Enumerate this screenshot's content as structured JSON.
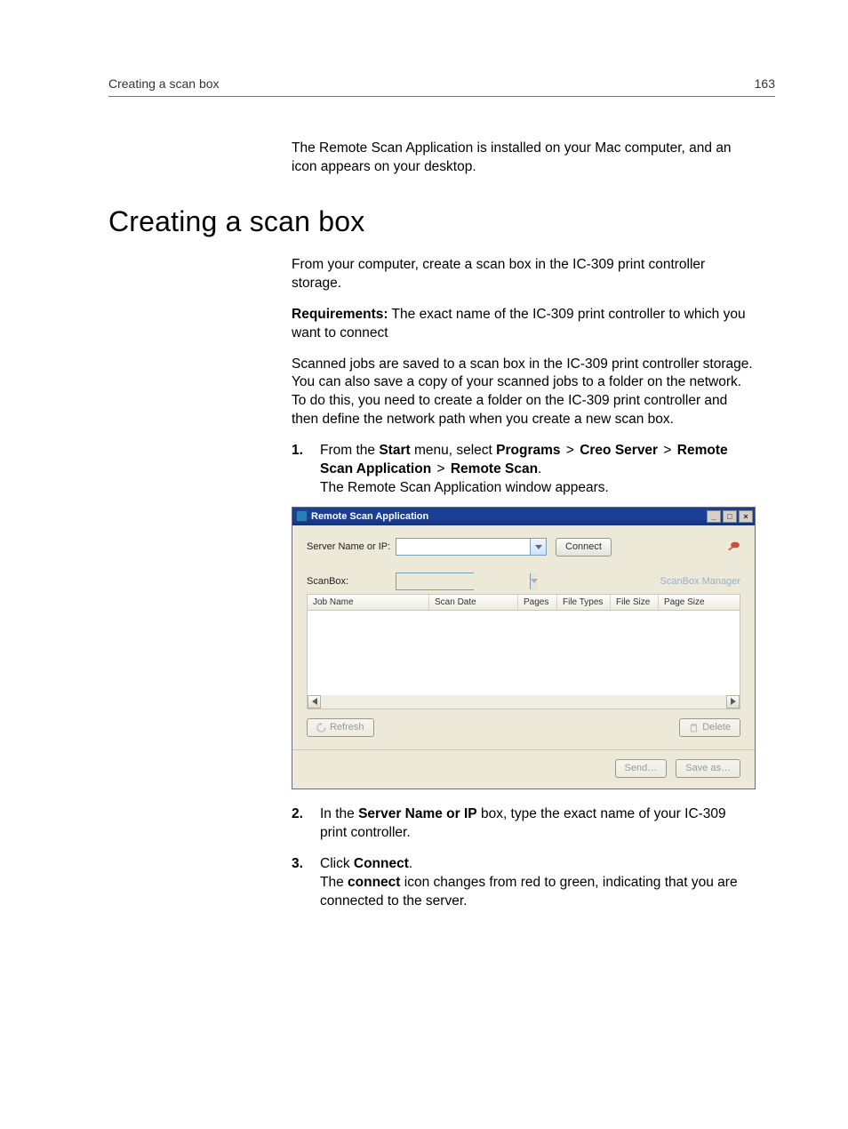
{
  "page_header": {
    "left": "Creating a scan box",
    "right": "163"
  },
  "intro": "The Remote Scan Application is installed on your Mac computer, and an icon appears on your desktop.",
  "h1": "Creating a scan box",
  "p1": "From your computer, create a scan box in the IC-309 print controller storage.",
  "p2_bold": "Requirements:",
  "p2_rest": " The exact name of the IC-309 print controller to which you want to connect",
  "p3": "Scanned jobs are saved to a scan box in the IC-309 print controller storage. You can also save a copy of your scanned jobs to a folder on the network. To do this, you need to create a folder on the IC-309 print controller and then define the network path when you create a new scan box.",
  "steps": {
    "s1": {
      "num": "1.",
      "pre": "From the ",
      "start": "Start",
      "mid1": " menu, select ",
      "programs": "Programs",
      "gt1": " > ",
      "creo": "Creo Server",
      "gt2": " > ",
      "rsa": "Remote Scan Application",
      "gt3": " > ",
      "rs": "Remote Scan",
      "dot": ".",
      "result": "The Remote Scan Application window appears."
    },
    "s2": {
      "num": "2.",
      "pre": "In the ",
      "field": "Server Name or IP",
      "post": " box, type the exact name of your IC-309 print controller."
    },
    "s3": {
      "num": "3.",
      "pre": "Click ",
      "btn": "Connect",
      "dot": ".",
      "result_pre": "The ",
      "result_bold": "connect",
      "result_post": " icon changes from red to green, indicating that you are connected to the server."
    }
  },
  "app": {
    "title": "Remote Scan Application",
    "server_label": "Server Name or IP:",
    "server_value": "",
    "connect_btn": "Connect",
    "scanbox_label": "ScanBox:",
    "scanbox_value": "",
    "manager_link": "ScanBox Manager",
    "columns": {
      "job_name": "Job Name",
      "scan_date": "Scan Date",
      "pages": "Pages",
      "file_types": "File Types",
      "file_size": "File Size",
      "page_size": "Page Size"
    },
    "refresh_btn": "Refresh",
    "delete_btn": "Delete",
    "send_btn": "Send…",
    "saveas_btn": "Save as…"
  }
}
